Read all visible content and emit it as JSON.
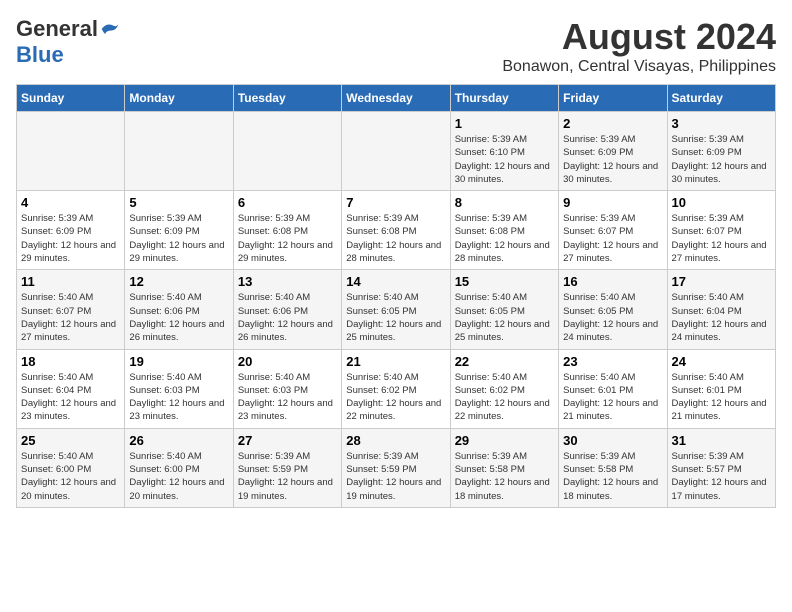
{
  "header": {
    "logo_general": "General",
    "logo_blue": "Blue",
    "main_title": "August 2024",
    "subtitle": "Bonawon, Central Visayas, Philippines"
  },
  "weekdays": [
    "Sunday",
    "Monday",
    "Tuesday",
    "Wednesday",
    "Thursday",
    "Friday",
    "Saturday"
  ],
  "weeks": [
    {
      "days": [
        {
          "number": "",
          "info": ""
        },
        {
          "number": "",
          "info": ""
        },
        {
          "number": "",
          "info": ""
        },
        {
          "number": "",
          "info": ""
        },
        {
          "number": "1",
          "info": "Sunrise: 5:39 AM\nSunset: 6:10 PM\nDaylight: 12 hours and 30 minutes."
        },
        {
          "number": "2",
          "info": "Sunrise: 5:39 AM\nSunset: 6:09 PM\nDaylight: 12 hours and 30 minutes."
        },
        {
          "number": "3",
          "info": "Sunrise: 5:39 AM\nSunset: 6:09 PM\nDaylight: 12 hours and 30 minutes."
        }
      ]
    },
    {
      "days": [
        {
          "number": "4",
          "info": "Sunrise: 5:39 AM\nSunset: 6:09 PM\nDaylight: 12 hours and 29 minutes."
        },
        {
          "number": "5",
          "info": "Sunrise: 5:39 AM\nSunset: 6:09 PM\nDaylight: 12 hours and 29 minutes."
        },
        {
          "number": "6",
          "info": "Sunrise: 5:39 AM\nSunset: 6:08 PM\nDaylight: 12 hours and 29 minutes."
        },
        {
          "number": "7",
          "info": "Sunrise: 5:39 AM\nSunset: 6:08 PM\nDaylight: 12 hours and 28 minutes."
        },
        {
          "number": "8",
          "info": "Sunrise: 5:39 AM\nSunset: 6:08 PM\nDaylight: 12 hours and 28 minutes."
        },
        {
          "number": "9",
          "info": "Sunrise: 5:39 AM\nSunset: 6:07 PM\nDaylight: 12 hours and 27 minutes."
        },
        {
          "number": "10",
          "info": "Sunrise: 5:39 AM\nSunset: 6:07 PM\nDaylight: 12 hours and 27 minutes."
        }
      ]
    },
    {
      "days": [
        {
          "number": "11",
          "info": "Sunrise: 5:40 AM\nSunset: 6:07 PM\nDaylight: 12 hours and 27 minutes."
        },
        {
          "number": "12",
          "info": "Sunrise: 5:40 AM\nSunset: 6:06 PM\nDaylight: 12 hours and 26 minutes."
        },
        {
          "number": "13",
          "info": "Sunrise: 5:40 AM\nSunset: 6:06 PM\nDaylight: 12 hours and 26 minutes."
        },
        {
          "number": "14",
          "info": "Sunrise: 5:40 AM\nSunset: 6:05 PM\nDaylight: 12 hours and 25 minutes."
        },
        {
          "number": "15",
          "info": "Sunrise: 5:40 AM\nSunset: 6:05 PM\nDaylight: 12 hours and 25 minutes."
        },
        {
          "number": "16",
          "info": "Sunrise: 5:40 AM\nSunset: 6:05 PM\nDaylight: 12 hours and 24 minutes."
        },
        {
          "number": "17",
          "info": "Sunrise: 5:40 AM\nSunset: 6:04 PM\nDaylight: 12 hours and 24 minutes."
        }
      ]
    },
    {
      "days": [
        {
          "number": "18",
          "info": "Sunrise: 5:40 AM\nSunset: 6:04 PM\nDaylight: 12 hours and 23 minutes."
        },
        {
          "number": "19",
          "info": "Sunrise: 5:40 AM\nSunset: 6:03 PM\nDaylight: 12 hours and 23 minutes."
        },
        {
          "number": "20",
          "info": "Sunrise: 5:40 AM\nSunset: 6:03 PM\nDaylight: 12 hours and 23 minutes."
        },
        {
          "number": "21",
          "info": "Sunrise: 5:40 AM\nSunset: 6:02 PM\nDaylight: 12 hours and 22 minutes."
        },
        {
          "number": "22",
          "info": "Sunrise: 5:40 AM\nSunset: 6:02 PM\nDaylight: 12 hours and 22 minutes."
        },
        {
          "number": "23",
          "info": "Sunrise: 5:40 AM\nSunset: 6:01 PM\nDaylight: 12 hours and 21 minutes."
        },
        {
          "number": "24",
          "info": "Sunrise: 5:40 AM\nSunset: 6:01 PM\nDaylight: 12 hours and 21 minutes."
        }
      ]
    },
    {
      "days": [
        {
          "number": "25",
          "info": "Sunrise: 5:40 AM\nSunset: 6:00 PM\nDaylight: 12 hours and 20 minutes."
        },
        {
          "number": "26",
          "info": "Sunrise: 5:40 AM\nSunset: 6:00 PM\nDaylight: 12 hours and 20 minutes."
        },
        {
          "number": "27",
          "info": "Sunrise: 5:39 AM\nSunset: 5:59 PM\nDaylight: 12 hours and 19 minutes."
        },
        {
          "number": "28",
          "info": "Sunrise: 5:39 AM\nSunset: 5:59 PM\nDaylight: 12 hours and 19 minutes."
        },
        {
          "number": "29",
          "info": "Sunrise: 5:39 AM\nSunset: 5:58 PM\nDaylight: 12 hours and 18 minutes."
        },
        {
          "number": "30",
          "info": "Sunrise: 5:39 AM\nSunset: 5:58 PM\nDaylight: 12 hours and 18 minutes."
        },
        {
          "number": "31",
          "info": "Sunrise: 5:39 AM\nSunset: 5:57 PM\nDaylight: 12 hours and 17 minutes."
        }
      ]
    }
  ]
}
